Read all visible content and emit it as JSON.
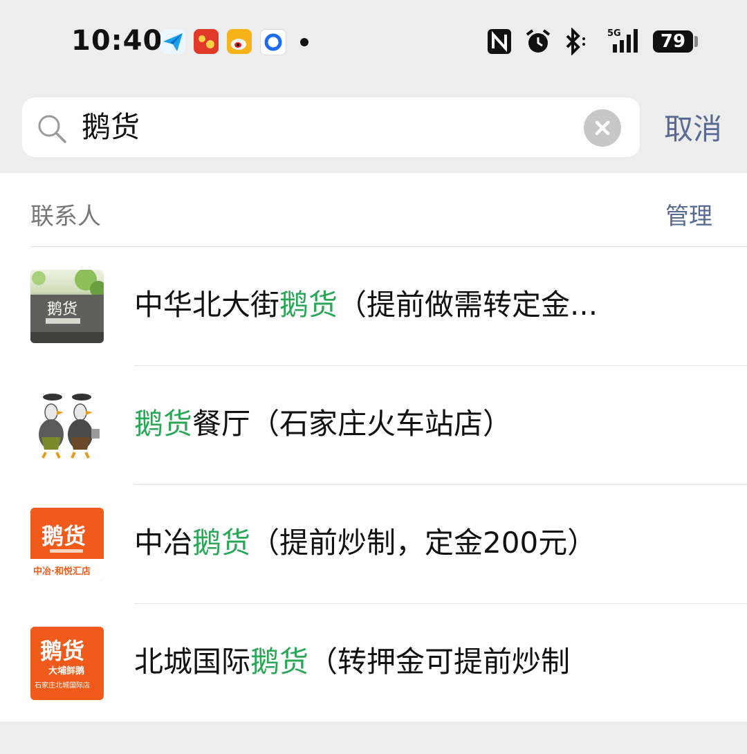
{
  "status_bar": {
    "time": "10:40",
    "app_icons": [
      "paper-plane-icon",
      "red-app-icon",
      "weibo-icon",
      "blue-circle-app-icon"
    ],
    "system_icons": [
      "nfc-icon",
      "alarm-icon",
      "bluetooth-icon",
      "5g-signal-icon"
    ],
    "network": "5G",
    "battery": "79"
  },
  "search": {
    "query": "鹅货",
    "cancel_label": "取消"
  },
  "contacts_section": {
    "title": "联系人",
    "manage_label": "管理",
    "items": [
      {
        "prefix": "中华北大街",
        "highlight": "鹅货",
        "suffix": "（提前做需转定金..."
      },
      {
        "prefix": "",
        "highlight": "鹅货",
        "suffix": "餐厅（石家庄火车站店）"
      },
      {
        "prefix": "中冶",
        "highlight": "鹅货",
        "suffix": "（提前炒制，定金200元）"
      },
      {
        "prefix": "北城国际",
        "highlight": "鹅货",
        "suffix": "（转押金可提前炒制"
      }
    ],
    "avatar_texts": [
      {
        "logo": "鹅货"
      },
      {
        "logo": ""
      },
      {
        "logo": "鹅货",
        "sub": "中冶·和悦汇店"
      },
      {
        "logo": "鹅货",
        "sub": "大埔鲜鹅",
        "sub2": "石家庄北城国际店"
      }
    ]
  },
  "colors": {
    "highlight": "#2aa657",
    "link": "#586a91",
    "avatar_orange": "#f05a1a"
  }
}
